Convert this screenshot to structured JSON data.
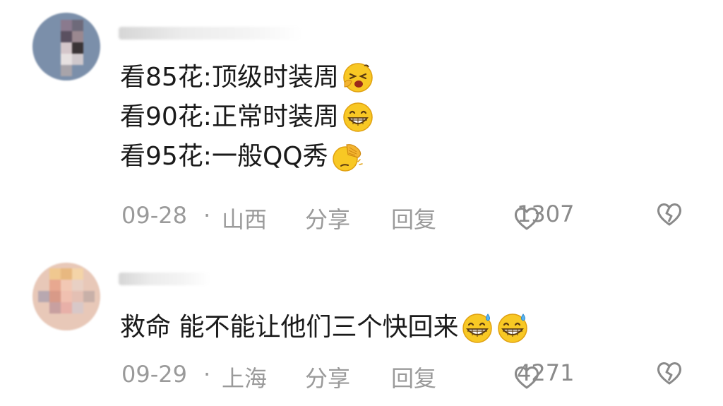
{
  "comments": [
    {
      "lines": [
        {
          "text": "看85花:顶级时装周",
          "emoji": "crying-laugh-emoji"
        },
        {
          "text": "看90花:正常时装周",
          "emoji": "grinning-emoji"
        },
        {
          "text": "看95花:一般QQ秀",
          "emoji": "facepalm-emoji"
        }
      ],
      "date": "09-28",
      "separator": "·",
      "location": "山西",
      "share_label": "分享",
      "reply_label": "回复",
      "like_count": "1307",
      "like_icon": "heart-icon",
      "dislike_icon": "broken-heart-icon"
    },
    {
      "lines": [
        {
          "text": "救命 能不能让他们三个快回来",
          "emoji": "grinning-sweat-emoji"
        }
      ],
      "date": "09-29",
      "separator": "·",
      "location": "上海",
      "share_label": "分享",
      "reply_label": "回复",
      "like_count": "4271",
      "like_icon": "heart-icon",
      "dislike_icon": "broken-heart-icon"
    }
  ],
  "colors": {
    "text": "#1a1a1a",
    "meta": "#9a9a9a",
    "emoji_fill": "#f8c824",
    "emoji_outline": "#e0a010"
  }
}
